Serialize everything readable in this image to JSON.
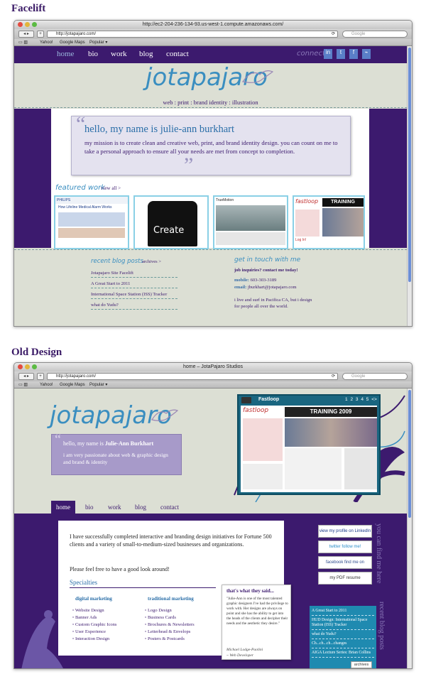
{
  "labels": {
    "facelift": "Facelift",
    "old_design": "Old Design"
  },
  "browser1": {
    "title": "http://ec2-204-236-134-93.us-west-1.compute.amazonaws.com/",
    "url": "http://jotapajaro.com/",
    "search_placeholder": "Google",
    "bookmarks": [
      "Yahoo!",
      "Google Maps",
      "Popular ▾"
    ]
  },
  "browser2": {
    "title": "home – JotaPajaro Studios",
    "url": "http://jotapajaro.com/",
    "search_placeholder": "Google",
    "bookmarks": [
      "Yahoo!",
      "Google Maps",
      "Popular ▾"
    ]
  },
  "site1": {
    "nav": [
      "home",
      "bio",
      "work",
      "blog",
      "contact"
    ],
    "connect": "connect",
    "logo": "jotapajaro",
    "tagline": "web : print : brand identity : illustration",
    "hello": "hello, my name is julie-ann burkhart",
    "mission": "my mission is to create clean and creative web, print, and brand identity design. you can count on me to take a personal approach to ensure all your needs are met from concept to completion.",
    "featured": "featured work",
    "view_all": "view all >",
    "thumb_texts": [
      "PHILIPS",
      "How Lifeline Medical Alarm Works",
      "Create",
      "TrueMotion",
      "fastloop",
      "TRAINING",
      "Log In!"
    ],
    "blog_heading": "recent blog posts",
    "archives": "archives >",
    "blog_posts": [
      "Jotapajaro Site Facelift",
      "A Great Start to 2011",
      "International Space Station (ISS) Tracker",
      "what do Yudu?"
    ],
    "contact_heading": "get in touch with me",
    "job": "job inquiries? contact me today!",
    "mobile_label": "mobile:",
    "mobile": "603-303-3189",
    "email_label": "email:",
    "email": "jburkhart@jotapajaro.com",
    "live": "i live and surf in Pacifica CA, but i design for people all over the world."
  },
  "site2": {
    "logo": "jotapajaro",
    "hello_prefix": "hello, my name is",
    "hello_name": "Julie-Ann Burkhart",
    "passion": "i am very passionate about web & graphic design and brand & identity",
    "portfolio_title": "Fastloop",
    "portfolio_training": "TRAINING 2009",
    "portfolio_pages": [
      "1",
      "2",
      "3",
      "4",
      "5",
      "<>"
    ],
    "nav": [
      "home",
      "bio",
      "work",
      "blog",
      "contact"
    ],
    "intro": "I have successfully completed interactive and branding design initiatives for Fortune 500 clients and a variety of small-to-medium-sized businesses and organizations.",
    "look": "Please feel free to have a good look around!",
    "specialties": "Specialties",
    "digital_heading": "digital marketing",
    "digital": [
      "Website Design",
      "Banner Ads",
      "Custom Graphic Icons",
      "User Experience",
      "Interaction Design"
    ],
    "traditional_heading": "traditional marketing",
    "traditional": [
      "Logo Design",
      "Business Cards",
      "Brochures & Newsletters",
      "Letterhead & Envelops",
      "Posters & Postcards"
    ],
    "said_heading": "that's what they said...",
    "quote": "\"Julie-Ann is one of the most talented graphic designers I've had the privilege to work with. Her designs are always on point and she has the ability to get into the heads of the clients and decipher their needs and the aesthetic they desire.\"",
    "quote_author": "Michael Lodge-Paolini",
    "quote_role": "~ Web Developer",
    "social": [
      "view my profile on LinkedIn",
      "twitter follow me!",
      "facebook find me on Facebook",
      "my PDF resume"
    ],
    "findme": "you can find me here",
    "recent_posts": "recent blog posts",
    "posts": [
      "A Great Start to 2011",
      "HUD Design: International Space Station (ISS) Tracker",
      "what do Yudu?",
      "Ch...ch...ch...changes",
      "AIGA Lecture Series: Brian Collins"
    ],
    "archives": "archives"
  }
}
